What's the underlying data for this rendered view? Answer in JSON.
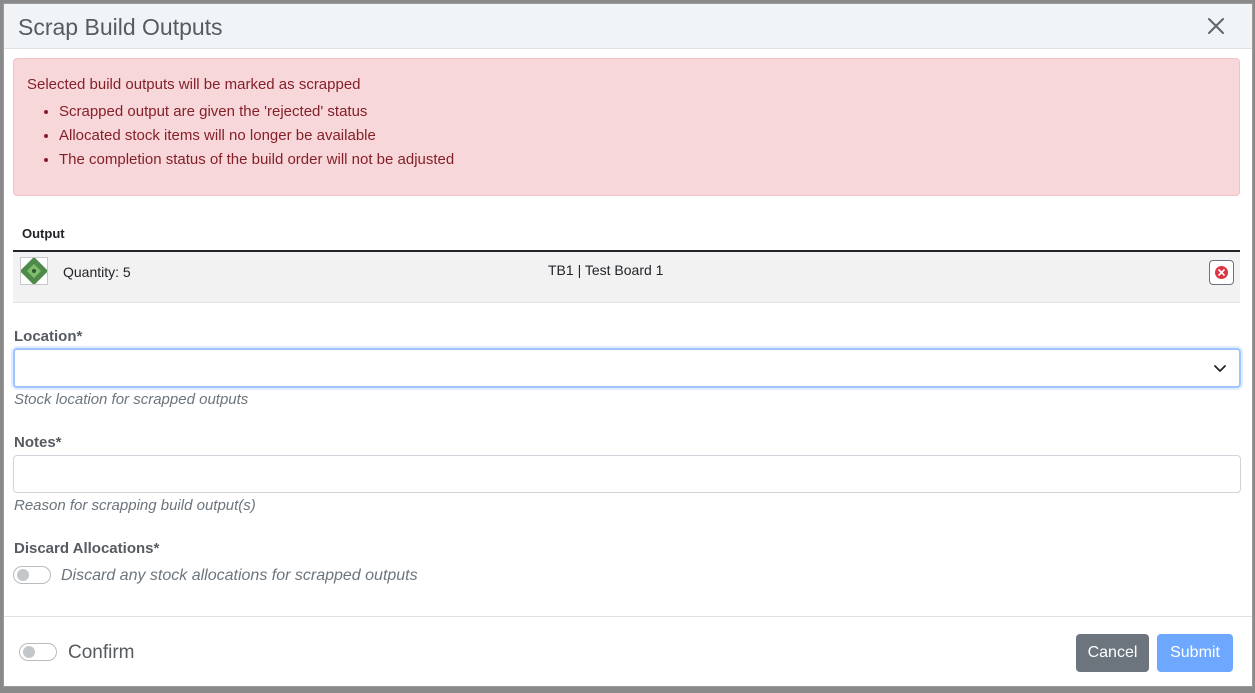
{
  "modal": {
    "title": "Scrap Build Outputs"
  },
  "alert": {
    "intro": "Selected build outputs will be marked as scrapped",
    "items": [
      "Scrapped output are given the 'rejected' status",
      "Allocated stock items will no longer be available",
      "The completion status of the build order will not be adjusted"
    ]
  },
  "table": {
    "header": "Output",
    "rows": [
      {
        "quantity": "Quantity: 5",
        "part": "TB1 | Test Board 1"
      }
    ]
  },
  "form": {
    "location": {
      "label": "Location*",
      "value": "",
      "help": "Stock location for scrapped outputs"
    },
    "notes": {
      "label": "Notes*",
      "value": "",
      "help": "Reason for scrapping build output(s)"
    },
    "discard": {
      "label": "Discard Allocations*",
      "toggle_text": "Discard any stock allocations for scrapped outputs",
      "checked": false
    }
  },
  "footer": {
    "confirm_label": "Confirm",
    "cancel_label": "Cancel",
    "submit_label": "Submit"
  },
  "colors": {
    "alert_bg": "#f8d7da",
    "alert_text": "#842029",
    "submit_bg": "#6ea8fe",
    "cancel_bg": "#6c757d"
  }
}
